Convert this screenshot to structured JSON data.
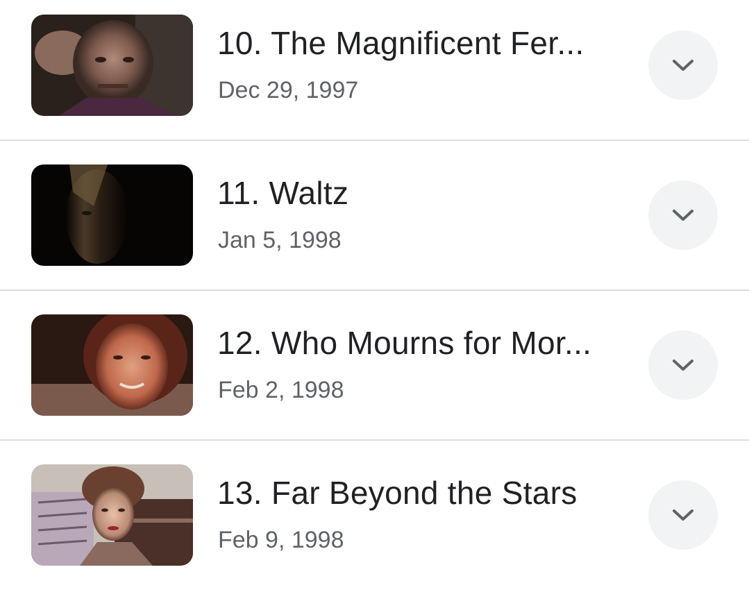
{
  "episodes": [
    {
      "title": "10. The Magnificent Fer...",
      "date": "Dec 29, 1997"
    },
    {
      "title": "11. Waltz",
      "date": "Jan 5, 1998"
    },
    {
      "title": "12. Who Mourns for Mor...",
      "date": "Feb 2, 1998"
    },
    {
      "title": "13. Far Beyond the Stars",
      "date": "Feb 9, 1998"
    }
  ],
  "icons": {
    "expand": "chevron-down-icon"
  },
  "colors": {
    "title": "#202124",
    "date": "#5f6368",
    "button_bg": "#f1f3f4",
    "divider": "#dcdcdc"
  }
}
